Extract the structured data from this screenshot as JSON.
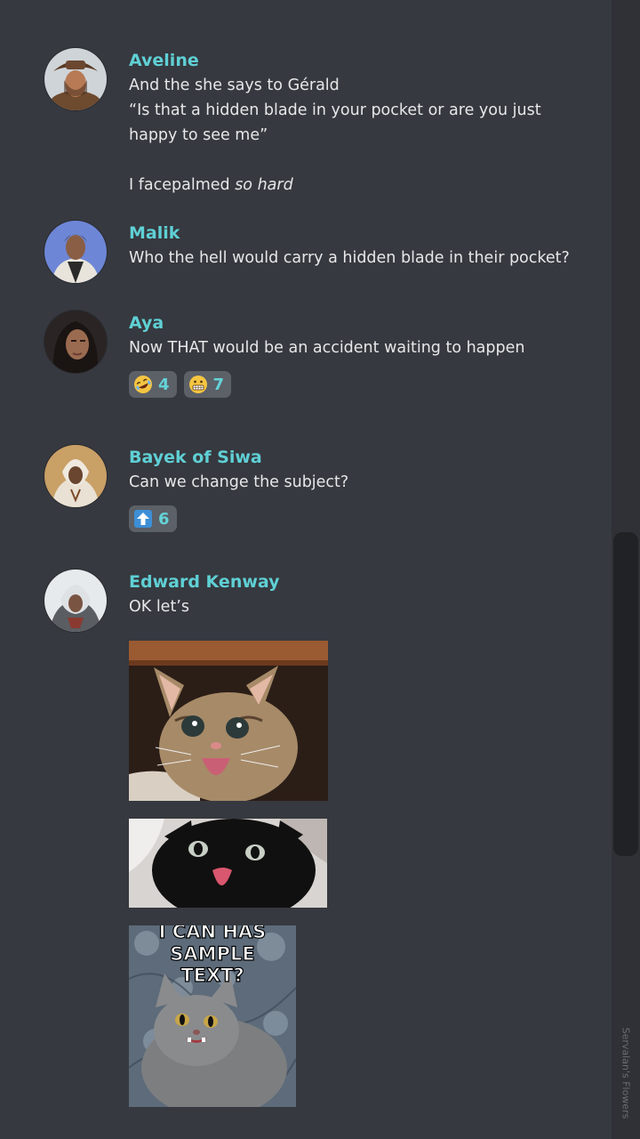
{
  "messages": [
    {
      "author": "Aveline",
      "avatar": "aveline-avatar",
      "lines": [
        "And the she says to Gérald",
        "“Is that a hidden blade in your pocket or are you just",
        "happy to see me”"
      ],
      "after_gap_text": "I facepalmed ",
      "after_gap_emphasis": "so hard"
    },
    {
      "author": "Malik",
      "avatar": "malik-avatar",
      "lines": [
        "Who the hell would carry a hidden blade in their pocket?"
      ]
    },
    {
      "author": "Aya",
      "avatar": "aya-avatar",
      "lines": [
        "Now THAT would be an accident waiting to happen"
      ],
      "reactions": [
        {
          "emoji": "rolling-on-floor-laughing-emoji",
          "count": "4"
        },
        {
          "emoji": "grimacing-face-emoji",
          "count": "7"
        }
      ]
    },
    {
      "author": "Bayek of Siwa",
      "avatar": "bayek-avatar",
      "lines": [
        "Can we change the subject?"
      ],
      "reactions": [
        {
          "emoji": "up-arrow-emoji",
          "count": "6"
        }
      ]
    },
    {
      "author": "Edward Kenway",
      "avatar": "edward-avatar",
      "lines": [
        "OK let’s"
      ],
      "images": [
        {
          "name": "surprised-kitten-image"
        },
        {
          "name": "black-cat-tongue-image"
        },
        {
          "name": "i-can-has-sample-text-cat-image",
          "caption": "I CAN HAS SAMPLE TEXT?"
        }
      ]
    }
  ],
  "side_credit": "Servalan's Flowers",
  "colors": {
    "background": "#36393f",
    "author_name": "#5fd0d5",
    "message_text": "#e6e7e8",
    "reaction_bg": "#5c6067",
    "scrollbar_track": "#2f3136",
    "scrollbar_thumb": "#202225"
  }
}
